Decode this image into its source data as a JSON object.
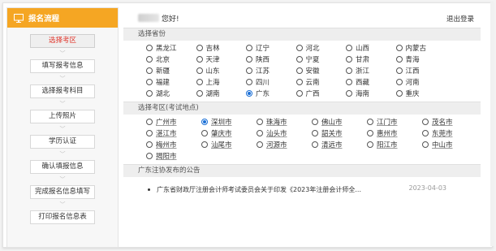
{
  "sidebar": {
    "header_title": "报名流程",
    "steps": [
      {
        "label": "选择考区"
      },
      {
        "label": "填写报考信息"
      },
      {
        "label": "选择报考科目"
      },
      {
        "label": "上传照片"
      },
      {
        "label": "学历认证"
      },
      {
        "label": "确认填报信息"
      },
      {
        "label": "完成报名信息填写"
      },
      {
        "label": "打印报名信息表"
      }
    ],
    "arrow": "﹀"
  },
  "header": {
    "greeting": "您好!",
    "logout_label": "退出登录"
  },
  "province_section": {
    "title": "选择省份",
    "selected": "广东",
    "options": [
      "黑龙江",
      "吉林",
      "辽宁",
      "河北",
      "山西",
      "内蒙古",
      "北京",
      "天津",
      "陕西",
      "宁夏",
      "甘肃",
      "青海",
      "新疆",
      "山东",
      "江苏",
      "安徽",
      "浙江",
      "江西",
      "福建",
      "上海",
      "四川",
      "云南",
      "西藏",
      "河南",
      "湖北",
      "湖南",
      "广东",
      "广西",
      "海南",
      "重庆"
    ]
  },
  "city_section": {
    "title": "选择考区(考试地点)",
    "selected": "深圳市",
    "options": [
      "广州市",
      "深圳市",
      "珠海市",
      "佛山市",
      "江门市",
      "茂名市",
      "湛江市",
      "肇庆市",
      "汕头市",
      "韶关市",
      "惠州市",
      "东莞市",
      "梅州市",
      "汕尾市",
      "河源市",
      "清远市",
      "阳江市",
      "中山市",
      "揭阳市"
    ]
  },
  "notice_section": {
    "title": "广东注协发布的公告",
    "items": [
      {
        "text": "广东省财政厅注册会计师考试委员会关于印发《2023年注册会计师全...",
        "date": "2023-04-03"
      }
    ]
  },
  "colors": {
    "accent": "#f5a623",
    "active_step": "#e0352b",
    "radio_checked": "#1a6fd6"
  }
}
